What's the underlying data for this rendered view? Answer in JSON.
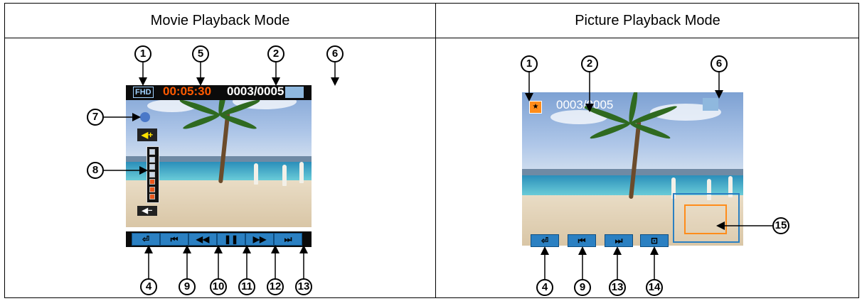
{
  "table": {
    "left_header": "Movie Playback Mode",
    "right_header": "Picture Playback Mode"
  },
  "movie": {
    "resolution_icon": "FHD",
    "time": "00:05:30",
    "counter": "0003/0005",
    "volume_up_icon": "◀+",
    "volume_down_icon": "◀−",
    "volume_level": 0.43,
    "controls": [
      {
        "icon": "return-icon",
        "glyph": "⏎"
      },
      {
        "icon": "previous-icon",
        "glyph": "⏮"
      },
      {
        "icon": "rewind-icon",
        "glyph": "◀◀"
      },
      {
        "icon": "pause-icon",
        "glyph": "❚❚"
      },
      {
        "icon": "fast-forward-icon",
        "glyph": "▶▶"
      },
      {
        "icon": "next-icon",
        "glyph": "⏭"
      }
    ],
    "callouts": [
      "1",
      "5",
      "2",
      "6",
      "7",
      "8",
      "4",
      "9",
      "10",
      "11",
      "12",
      "13"
    ]
  },
  "picture": {
    "counter": "0003/0005",
    "controls": [
      {
        "icon": "return-icon",
        "glyph": "⏎"
      },
      {
        "icon": "previous-icon",
        "glyph": "⏮"
      },
      {
        "icon": "next-icon",
        "glyph": "⏭"
      },
      {
        "icon": "zoom-icon",
        "glyph": "⊡"
      }
    ],
    "callouts": [
      "1",
      "2",
      "6",
      "4",
      "9",
      "13",
      "14",
      "15"
    ]
  },
  "colors": {
    "osd_time": "#ff5a00",
    "osd_white": "#ffffff",
    "control_blue": "#2b80c2",
    "zoom_frame": "#ff8c1a"
  }
}
